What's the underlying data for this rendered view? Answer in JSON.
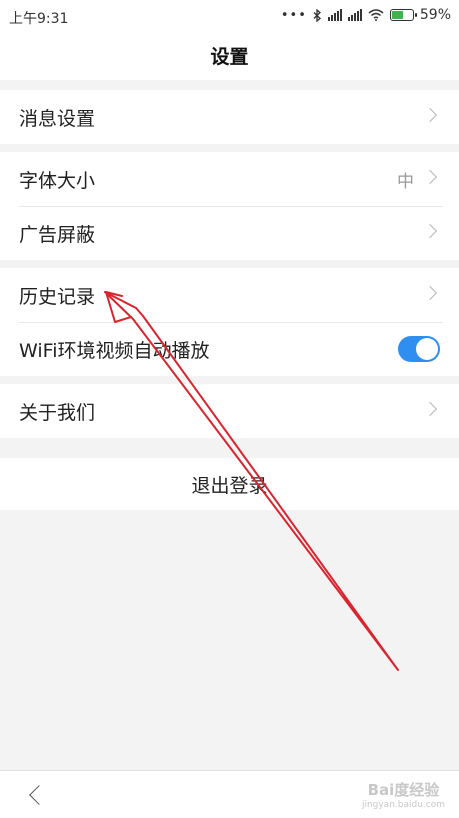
{
  "status_bar": {
    "time": "上午9:31",
    "dots": "•••",
    "bluetooth": "bluetooth-icon",
    "wifi": "wifi-icon",
    "battery_percent": "59%",
    "battery_level": 0.59,
    "battery_color": "#3fb34f"
  },
  "header": {
    "title": "设置"
  },
  "settings": {
    "message_settings": "消息设置",
    "font_size": "字体大小",
    "font_size_value": "中",
    "ad_block": "广告屏蔽",
    "history": "历史记录",
    "wifi_autoplay": "WiFi环境视频自动播放",
    "wifi_autoplay_on": true,
    "about_us": "关于我们"
  },
  "logout": {
    "label": "退出登录"
  },
  "watermark": {
    "line1": "Bai度经验",
    "line2": "jingyan.baidu.com"
  },
  "colors": {
    "toggle_on": "#2f8ff0",
    "annotation_arrow": "#d9252e"
  }
}
